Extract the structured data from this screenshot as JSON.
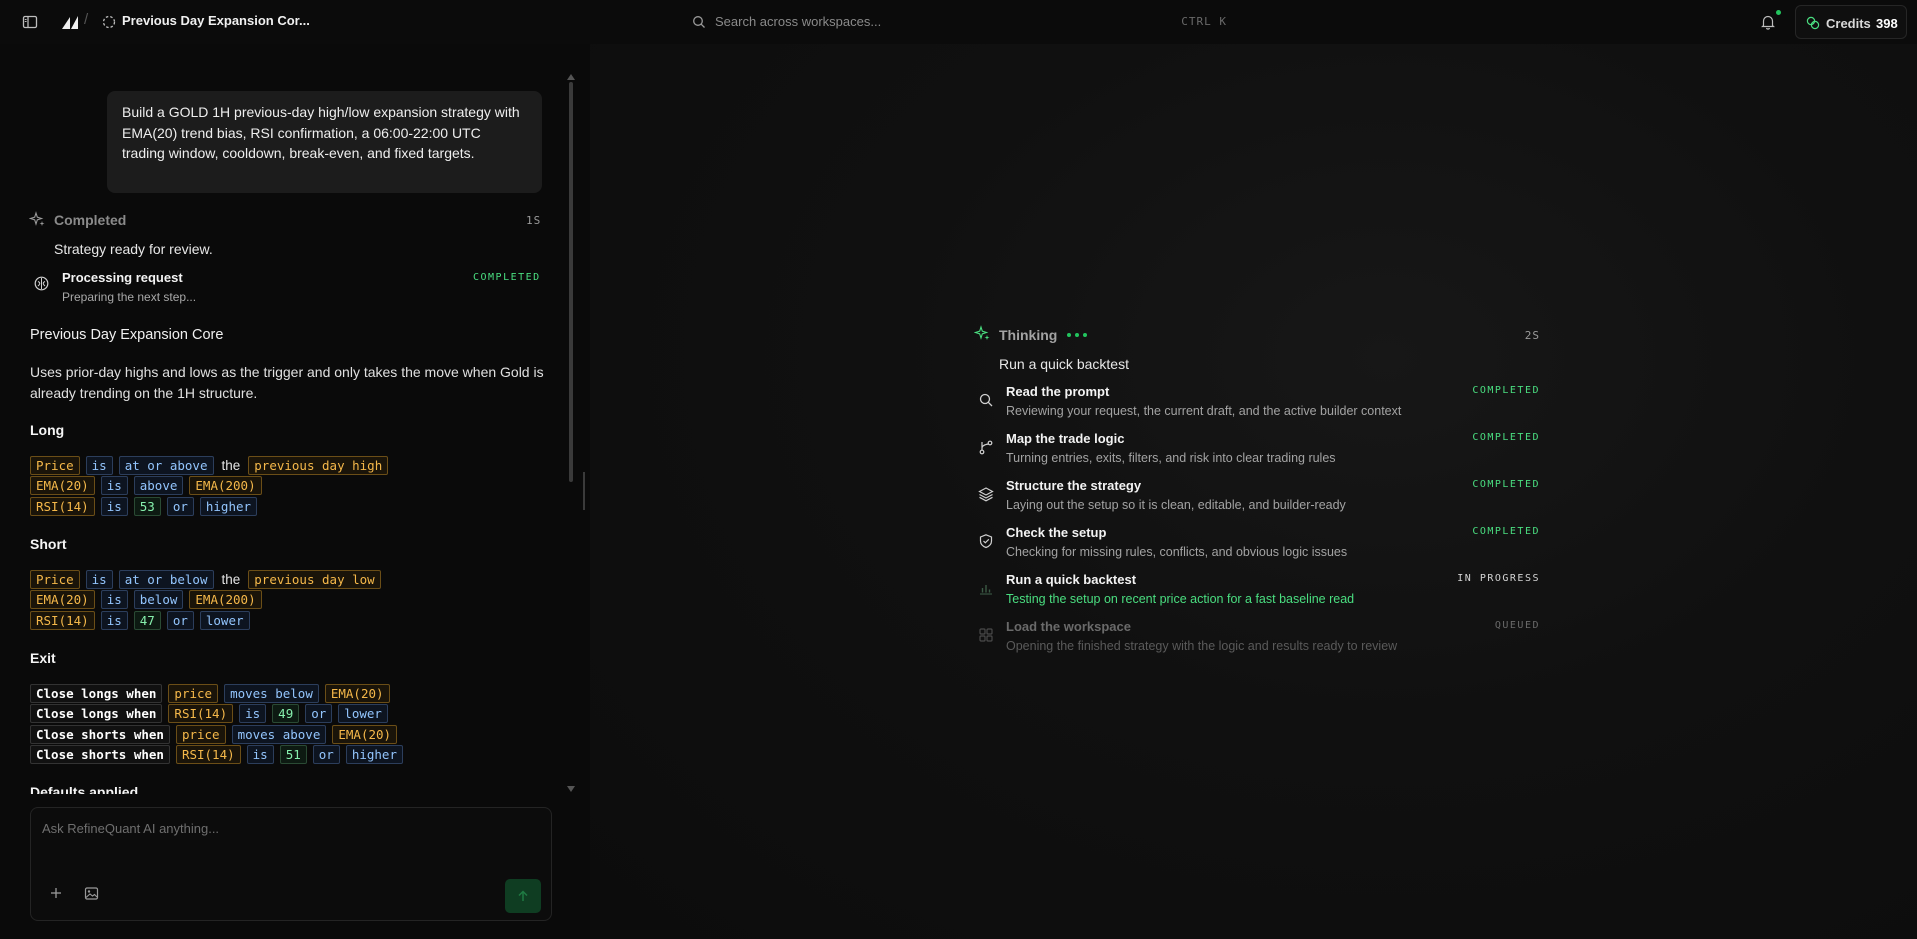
{
  "topbar": {
    "title": "Previous Day Expansion Cor...",
    "separator": "/",
    "search_placeholder": "Search across workspaces...",
    "search_shortcut": "CTRL K",
    "credits_label": "Credits",
    "credits_value": "398"
  },
  "chat": {
    "user_message": "Build a GOLD 1H previous-day high/low expansion strategy with EMA(20) trend bias, RSI confirmation, a 06:00-22:00 UTC trading window, cooldown, break-even, and fixed targets.",
    "status_label": "Completed",
    "status_time": "1S",
    "status_message": "Strategy ready for review.",
    "step_title": "Processing request",
    "step_sub": "Preparing the next step...",
    "step_tag": "COMPLETED",
    "strategy_name": "Previous Day Expansion Core",
    "strategy_description": "Uses prior-day highs and lows as the trigger and only takes the move when Gold is already trending on the 1H structure.",
    "long_heading": "Long",
    "long_rules": [
      [
        [
          "ind",
          "Price"
        ],
        [
          "op",
          "is"
        ],
        [
          "op",
          "at or above"
        ],
        [
          "plain",
          "the"
        ],
        [
          "ind",
          "previous day high"
        ]
      ],
      [
        [
          "ind",
          "EMA(20)"
        ],
        [
          "op",
          "is"
        ],
        [
          "op",
          "above"
        ],
        [
          "ind",
          "EMA(200)"
        ]
      ],
      [
        [
          "ind",
          "RSI(14)"
        ],
        [
          "op",
          "is"
        ],
        [
          "num",
          "53"
        ],
        [
          "op",
          "or"
        ],
        [
          "op",
          "higher"
        ]
      ]
    ],
    "short_heading": "Short",
    "short_rules": [
      [
        [
          "ind",
          "Price"
        ],
        [
          "op",
          "is"
        ],
        [
          "op",
          "at or below"
        ],
        [
          "plain",
          "the"
        ],
        [
          "ind",
          "previous day low"
        ]
      ],
      [
        [
          "ind",
          "EMA(20)"
        ],
        [
          "op",
          "is"
        ],
        [
          "op",
          "below"
        ],
        [
          "ind",
          "EMA(200)"
        ]
      ],
      [
        [
          "ind",
          "RSI(14)"
        ],
        [
          "op",
          "is"
        ],
        [
          "num",
          "47"
        ],
        [
          "op",
          "or"
        ],
        [
          "op",
          "lower"
        ]
      ]
    ],
    "exit_heading": "Exit",
    "exit_rules": [
      [
        [
          "exit",
          "Close longs when"
        ],
        [
          "ind",
          "price"
        ],
        [
          "op",
          "moves below"
        ],
        [
          "ind",
          "EMA(20)"
        ]
      ],
      [
        [
          "exit",
          "Close longs when"
        ],
        [
          "ind",
          "RSI(14)"
        ],
        [
          "op",
          "is"
        ],
        [
          "num",
          "49"
        ],
        [
          "op",
          "or"
        ],
        [
          "op",
          "lower"
        ]
      ],
      [
        [
          "exit",
          "Close shorts when"
        ],
        [
          "ind",
          "price"
        ],
        [
          "op",
          "moves above"
        ],
        [
          "ind",
          "EMA(20)"
        ]
      ],
      [
        [
          "exit",
          "Close shorts when"
        ],
        [
          "ind",
          "RSI(14)"
        ],
        [
          "op",
          "is"
        ],
        [
          "num",
          "51"
        ],
        [
          "op",
          "or"
        ],
        [
          "op",
          "higher"
        ]
      ]
    ],
    "defaults_heading": "Defaults applied",
    "input_placeholder": "Ask RefineQuant AI anything..."
  },
  "thinking": {
    "label": "Thinking",
    "time": "2S",
    "current": "Run a quick backtest",
    "steps": [
      {
        "title": "Read the prompt",
        "sub": "Reviewing your request, the current draft, and the active builder context",
        "status": "COMPLETED",
        "icon": "search-icon"
      },
      {
        "title": "Map the trade logic",
        "sub": "Turning entries, exits, filters, and risk into clear trading rules",
        "status": "COMPLETED",
        "icon": "branch-icon"
      },
      {
        "title": "Structure the strategy",
        "sub": "Laying out the setup so it is clean, editable, and builder-ready",
        "status": "COMPLETED",
        "icon": "layers-icon"
      },
      {
        "title": "Check the setup",
        "sub": "Checking for missing rules, conflicts, and obvious logic issues",
        "status": "COMPLETED",
        "icon": "shield-check-icon"
      },
      {
        "title": "Run a quick backtest",
        "sub": "Testing the setup on recent price action for a fast baseline read",
        "status": "IN PROGRESS",
        "icon": "bar-chart-icon"
      },
      {
        "title": "Load the workspace",
        "sub": "Opening the finished strategy with the logic and results ready to review",
        "status": "QUEUED",
        "icon": "grid-icon"
      }
    ]
  },
  "colors": {
    "accent_green": "#4ade80",
    "indicator_amber": "#f5b84a",
    "operator_blue": "#93c5fd"
  }
}
